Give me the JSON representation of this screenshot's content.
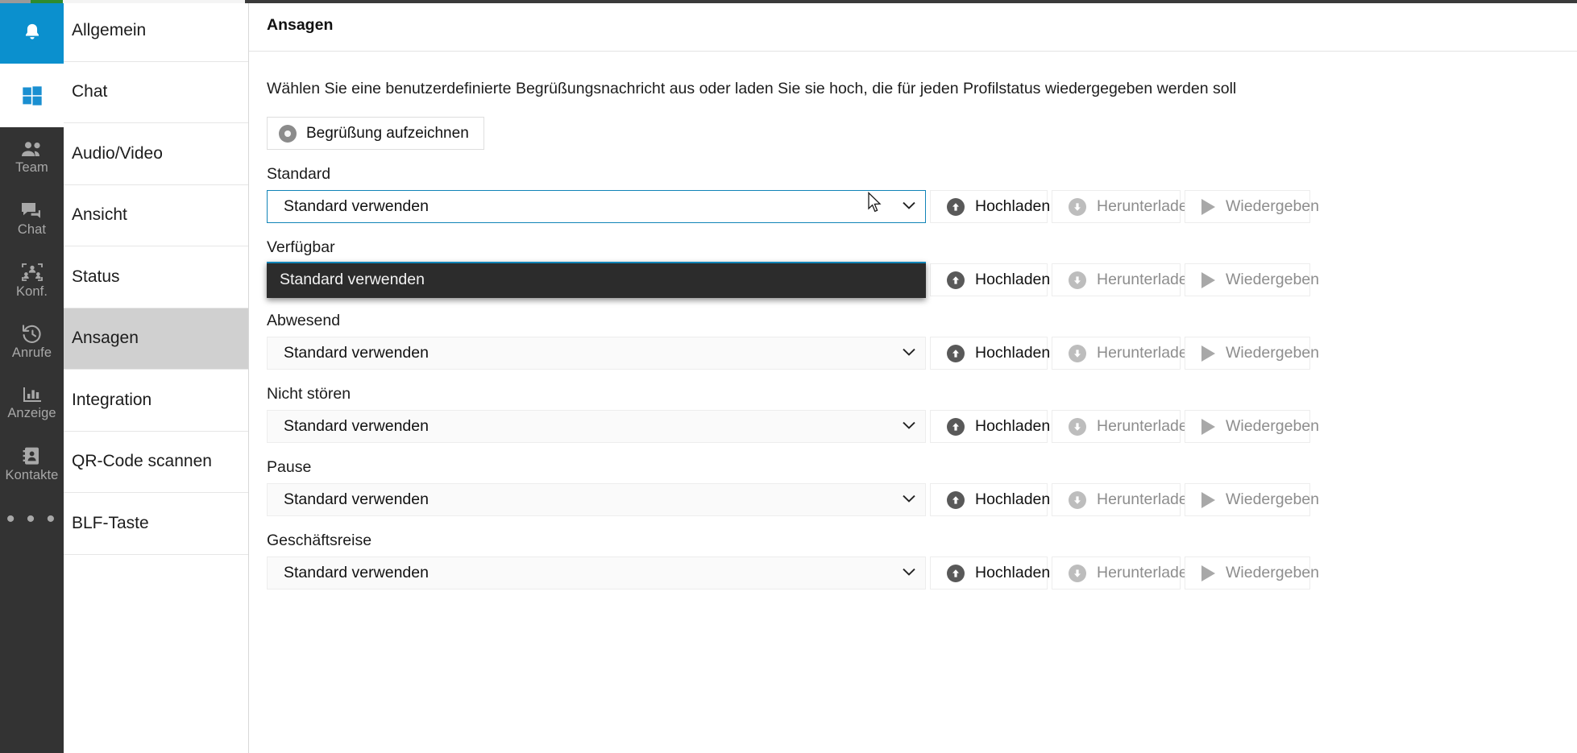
{
  "window": {
    "accent_blue": "#0b90ce",
    "rail_bg": "#333333",
    "focus_border": "#1184b7",
    "dropdown_bg": "#2c2c2c",
    "active_nav_bg": "#d0d0d0"
  },
  "rail": {
    "bell": {
      "label": "",
      "icon": "bell-icon"
    },
    "windows": {
      "label": "",
      "icon": "windows-logo-icon"
    },
    "items": [
      {
        "label": "Team",
        "icon": "people-icon"
      },
      {
        "label": "Chat",
        "icon": "chat-bubbles-icon"
      },
      {
        "label": "Konf.",
        "icon": "conference-icon"
      },
      {
        "label": "Anrufe",
        "icon": "call-history-icon"
      },
      {
        "label": "Anzeige",
        "icon": "bar-chart-icon"
      },
      {
        "label": "Kontakte",
        "icon": "contact-card-icon"
      }
    ],
    "more": {
      "label": "• • •",
      "icon": "more-dots-icon"
    }
  },
  "nav": {
    "items": [
      {
        "label": "Allgemein",
        "active": false
      },
      {
        "label": "Chat",
        "active": false
      },
      {
        "label": "Audio/Video",
        "active": false
      },
      {
        "label": "Ansicht",
        "active": false
      },
      {
        "label": "Status",
        "active": false
      },
      {
        "label": "Ansagen",
        "active": true
      },
      {
        "label": "Integration",
        "active": false
      },
      {
        "label": "QR-Code scannen",
        "active": false
      },
      {
        "label": "BLF-Taste",
        "active": false
      }
    ]
  },
  "main": {
    "title": "Ansagen",
    "description": "Wählen Sie eine benutzerdefinierte Begrüßungsnachricht aus oder laden Sie sie hoch, die für jeden Profilstatus wiedergegeben werden soll",
    "record_button": {
      "label": "Begrüßung aufzeichnen",
      "icon": "record-dot-icon"
    },
    "buttons": {
      "upload": {
        "label": "Hochladen",
        "icon": "upload-circle-icon",
        "enabled": true
      },
      "download": {
        "label": "Herunterladen",
        "icon": "download-circle-icon",
        "enabled": false
      },
      "play": {
        "label": "Wiedergeben",
        "icon": "play-triangle-icon",
        "enabled": false
      }
    },
    "select_options": [
      "Standard verwenden"
    ],
    "rows": [
      {
        "label": "Standard",
        "value": "Standard verwenden",
        "focused": true
      },
      {
        "label": "Verfügbar",
        "value": "Standard verwenden",
        "focused": false
      },
      {
        "label": "Abwesend",
        "value": "Standard verwenden",
        "focused": false
      },
      {
        "label": "Nicht stören",
        "value": "Standard verwenden",
        "focused": false
      },
      {
        "label": "Pause",
        "value": "Standard verwenden",
        "focused": false
      },
      {
        "label": "Geschäftsreise",
        "value": "Standard verwenden",
        "focused": false
      }
    ]
  },
  "dropdown": {
    "open": true,
    "selected_option": "Standard verwenden"
  }
}
